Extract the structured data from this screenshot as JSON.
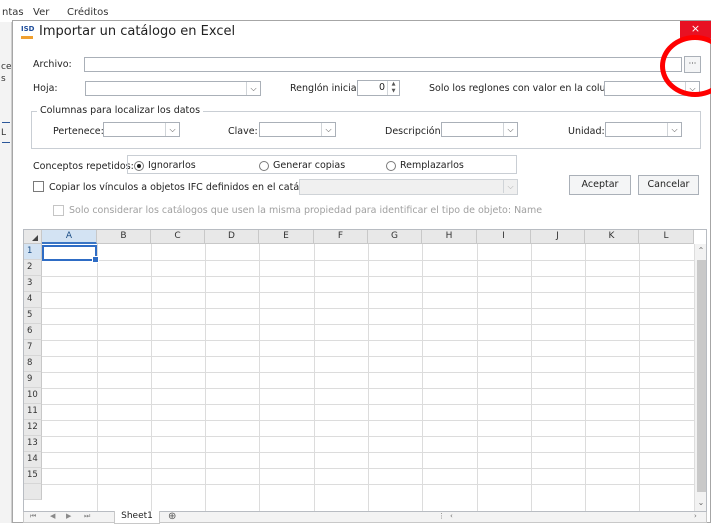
{
  "background": {
    "menu": [
      "ntas",
      "Ver",
      "Créditos"
    ],
    "left_labels": [
      "ce",
      "s",
      "L"
    ]
  },
  "window": {
    "title": "Importar un catálogo en Excel",
    "icon_text": "ISD",
    "close_glyph": "×"
  },
  "form": {
    "archivo_label": "Archivo:",
    "archivo_value": "",
    "browse_button": "···",
    "hoja_label": "Hoja:",
    "hoja_value": "",
    "renglon_label": "Renglón inicial:",
    "renglon_value": "0",
    "solo_label": "Solo los reglones con valor en la columna:",
    "solo_value": ""
  },
  "columns_group": {
    "title": "Columnas para localizar los datos",
    "pertenece_label": "Pertenece:",
    "clave_label": "Clave:",
    "descripcion_label": "Descripción:",
    "unidad_label": "Unidad:"
  },
  "repeated": {
    "label": "Conceptos repetidos:",
    "options": [
      "Ignorarlos",
      "Generar copias",
      "Remplazarlos"
    ],
    "selected": "Ignorarlos"
  },
  "copy_links": {
    "label": "Copiar los vínculos a objetos IFC definidos en el catálogo:",
    "checked": false
  },
  "only_consider": {
    "label": "Solo considerar los catálogos que usen la misma propiedad para identificar el tipo de objeto: Name",
    "checked": false
  },
  "buttons": {
    "accept": "Aceptar",
    "cancel": "Cancelar"
  },
  "grid": {
    "columns": [
      "A",
      "B",
      "C",
      "D",
      "E",
      "F",
      "G",
      "H",
      "I",
      "J",
      "K",
      "L"
    ],
    "rows": [
      "1",
      "2",
      "3",
      "4",
      "5",
      "6",
      "7",
      "8",
      "9",
      "10",
      "11",
      "12",
      "13",
      "14",
      "15"
    ],
    "active_cell": "A1",
    "sheet_tab": "Sheet1",
    "add_sheet_glyph": "⊕",
    "nav_glyphs": [
      "⏮",
      "◀",
      "▶",
      "⏭"
    ]
  },
  "colors": {
    "close_red": "#e81123",
    "selection_blue": "#2e6cc5",
    "annotation_red": "#ff0000"
  }
}
